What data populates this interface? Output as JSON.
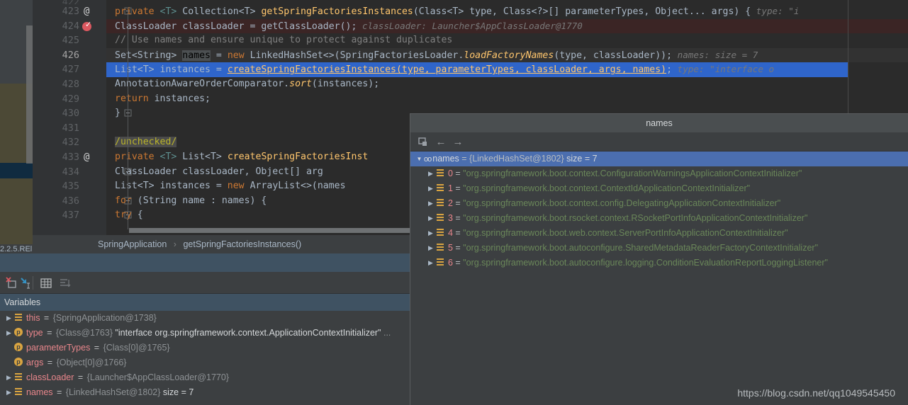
{
  "editor": {
    "version_label_line1": "2.2.5.REl",
    "version_label_line2": "......",
    "margin_hint_426": "names:   size = 7",
    "margin_hint_423": "type:  \"i",
    "lines": [
      {
        "num": "423",
        "gutter_mark": "@",
        "segments": [
          {
            "t": "private ",
            "c": "kw"
          },
          {
            "t": "<T> ",
            "c": "gtype"
          },
          {
            "t": "Collection<T> ",
            "c": "typ"
          },
          {
            "t": "getSpringFactoriesInstances",
            "c": "fn"
          },
          {
            "t": "(Class<T> type, Class<?>[] parameterTypes, Object... args) {",
            "c": "typ"
          },
          {
            "t": "   type: \"i",
            "c": "hint"
          }
        ]
      },
      {
        "num": "424",
        "gutter_mark": "breakpoint",
        "background": "breakpoint",
        "segments": [
          {
            "t": "    ClassLoader classLoader = getClassLoader();",
            "c": "typ"
          },
          {
            "t": "   classLoader: Launcher$AppClassLoader@1770",
            "c": "hint"
          }
        ]
      },
      {
        "num": "425",
        "gutter_mark": "",
        "segments": [
          {
            "t": "    // Use names and ensure unique to protect against duplicates",
            "c": "cmt"
          }
        ]
      },
      {
        "num": "426",
        "gutter_mark": "",
        "current": true,
        "segments": [
          {
            "t": "    Set<String> ",
            "c": "typ"
          },
          {
            "t": "names",
            "c": "hl-word"
          },
          {
            "t": " = ",
            "c": "typ"
          },
          {
            "t": "new ",
            "c": "kw"
          },
          {
            "t": "LinkedHashSet<>(SpringFactoriesLoader.",
            "c": "typ"
          },
          {
            "t": "loadFactoryNames",
            "c": "fn ital"
          },
          {
            "t": "(type, classLoader));",
            "c": "typ"
          },
          {
            "t": "   names:  size = 7",
            "c": "hint"
          }
        ]
      },
      {
        "num": "427",
        "gutter_mark": "",
        "background": "selected",
        "segments": [
          {
            "t": "    List<T> instances = ",
            "c": "typ"
          },
          {
            "t": "createSpringFactoriesInstances(type, parameterTypes, classLoader, args, names)",
            "c": "link"
          },
          {
            "t": ";",
            "c": "typ"
          },
          {
            "t": "   type: \"interface o",
            "c": "hint"
          }
        ]
      },
      {
        "num": "428",
        "gutter_mark": "",
        "segments": [
          {
            "t": "    AnnotationAwareOrderComparator.",
            "c": "typ"
          },
          {
            "t": "sort",
            "c": "fn ital"
          },
          {
            "t": "(instances);",
            "c": "typ"
          }
        ]
      },
      {
        "num": "429",
        "gutter_mark": "",
        "segments": [
          {
            "t": "    ",
            "c": "typ"
          },
          {
            "t": "return ",
            "c": "kw"
          },
          {
            "t": "instances;",
            "c": "typ"
          }
        ]
      },
      {
        "num": "430",
        "gutter_mark": "",
        "segments": [
          {
            "t": "}",
            "c": "typ"
          }
        ]
      },
      {
        "num": "431",
        "gutter_mark": "",
        "segments": []
      },
      {
        "num": "432",
        "gutter_mark": "",
        "segments": [
          {
            "t": "    ",
            "c": "typ"
          },
          {
            "t": "/unchecked/",
            "c": "unchecked-hl anno"
          }
        ]
      },
      {
        "num": "433",
        "gutter_mark": "@",
        "segments": [
          {
            "t": "private ",
            "c": "kw"
          },
          {
            "t": "<T> ",
            "c": "gtype"
          },
          {
            "t": "List<T> ",
            "c": "typ"
          },
          {
            "t": "createSpringFactoriesInst",
            "c": "fn"
          }
        ]
      },
      {
        "num": "434",
        "gutter_mark": "",
        "segments": [
          {
            "t": "        ClassLoader classLoader, Object[] arg",
            "c": "typ"
          }
        ]
      },
      {
        "num": "435",
        "gutter_mark": "",
        "segments": [
          {
            "t": "    List<T> instances = ",
            "c": "typ"
          },
          {
            "t": "new ",
            "c": "kw"
          },
          {
            "t": "ArrayList<>(names",
            "c": "typ"
          }
        ]
      },
      {
        "num": "436",
        "gutter_mark": "",
        "segments": [
          {
            "t": "    ",
            "c": "typ"
          },
          {
            "t": "for ",
            "c": "kw"
          },
          {
            "t": "(String name : names) {",
            "c": "typ"
          }
        ]
      },
      {
        "num": "437",
        "gutter_mark": "",
        "segments": [
          {
            "t": "        ",
            "c": "typ"
          },
          {
            "t": "try ",
            "c": "kw"
          },
          {
            "t": "{",
            "c": "typ"
          }
        ]
      }
    ]
  },
  "breadcrumb": {
    "class": "SpringApplication",
    "separator": "›",
    "method": "getSpringFactoriesInstances()"
  },
  "variables_panel": {
    "title": "Variables",
    "toolbar": [
      {
        "name": "mute-breakpoints-icon",
        "glyph": "✕"
      },
      {
        "name": "evaluate-expression-icon",
        "glyph": "↘"
      },
      {
        "name": "show-as-table-icon",
        "glyph": "▦"
      },
      {
        "name": "sort-values-icon",
        "glyph": "≡"
      }
    ],
    "rows": [
      {
        "expandable": true,
        "icon": "list",
        "name": "this",
        "ref": "{SpringApplication@1738}",
        "value": "",
        "size": "",
        "ellipsis": ""
      },
      {
        "expandable": true,
        "icon": "param",
        "name": "type",
        "ref": "{Class@1763}",
        "value": "\"interface org.springframework.context.ApplicationContextInitializer\"",
        "size": "",
        "ellipsis": "..."
      },
      {
        "expandable": false,
        "icon": "param",
        "name": "parameterTypes",
        "ref": "{Class[0]@1765}",
        "value": "",
        "size": "",
        "ellipsis": ""
      },
      {
        "expandable": false,
        "icon": "param",
        "name": "args",
        "ref": "{Object[0]@1766}",
        "value": "",
        "size": "",
        "ellipsis": ""
      },
      {
        "expandable": true,
        "icon": "list",
        "name": "classLoader",
        "ref": "{Launcher$AppClassLoader@1770}",
        "value": "",
        "size": "",
        "ellipsis": ""
      },
      {
        "expandable": true,
        "icon": "list",
        "name": "names",
        "ref": "{LinkedHashSet@1802}",
        "value": "",
        "size": "size = 7",
        "ellipsis": ""
      }
    ]
  },
  "popup": {
    "title": "names",
    "toolbar": [
      {
        "name": "jump-to-source-icon",
        "glyph": "▣"
      },
      {
        "name": "back-arrow-icon",
        "glyph": "←"
      },
      {
        "name": "forward-arrow-icon",
        "glyph": "→"
      }
    ],
    "root": {
      "name": "names",
      "ref": "{LinkedHashSet@1802}",
      "size": "size = 7"
    },
    "items": [
      {
        "index": "0",
        "value": "\"org.springframework.boot.context.ConfigurationWarningsApplicationContextInitializer\""
      },
      {
        "index": "1",
        "value": "\"org.springframework.boot.context.ContextIdApplicationContextInitializer\""
      },
      {
        "index": "2",
        "value": "\"org.springframework.boot.context.config.DelegatingApplicationContextInitializer\""
      },
      {
        "index": "3",
        "value": "\"org.springframework.boot.rsocket.context.RSocketPortInfoApplicationContextInitializer\""
      },
      {
        "index": "4",
        "value": "\"org.springframework.boot.web.context.ServerPortInfoApplicationContextInitializer\""
      },
      {
        "index": "5",
        "value": "\"org.springframework.boot.autoconfigure.SharedMetadataReaderFactoryContextInitializer\""
      },
      {
        "index": "6",
        "value": "\"org.springframework.boot.autoconfigure.logging.ConditionEvaluationReportLoggingListener\""
      }
    ]
  },
  "watermark": "https://blog.csdn.net/qq1049545450",
  "colors": {
    "editor_bg": "#2b2b2b",
    "gutter_bg": "#313335",
    "panel_bg": "#3c3f41",
    "selection_blue": "#2f65ca",
    "popup_select_blue": "#4b6eaf",
    "header_blue": "#3f5262",
    "breakpoint_red": "#db5860",
    "string_green": "#6a8759",
    "keyword_orange": "#cc7832",
    "method_yellow": "#ffc66d",
    "name_pink": "#e8868b"
  }
}
